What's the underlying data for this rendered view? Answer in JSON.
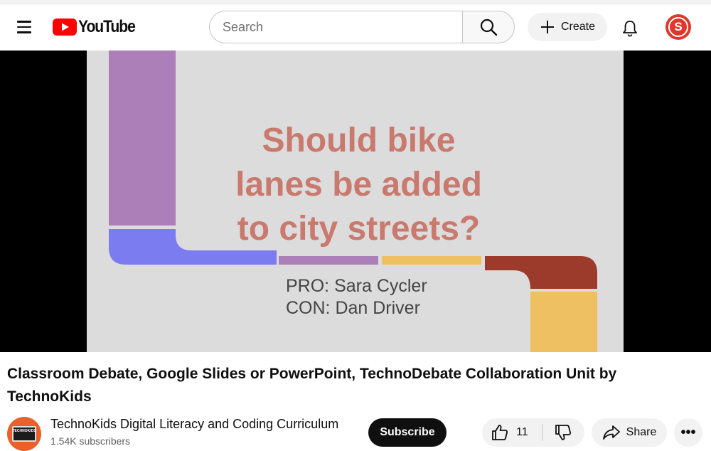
{
  "header": {
    "logo_text": "YouTube",
    "search_placeholder": "Search",
    "create_label": "Create",
    "avatar_letter": "S"
  },
  "slide": {
    "title_lines": [
      "Should bike",
      "lanes be added",
      "to city streets?"
    ],
    "pro_line": "PRO: Sara Cycler",
    "con_line": "CON: Dan Driver"
  },
  "video": {
    "title": "Classroom Debate, Google Slides or PowerPoint, TechnoDebate Collaboration Unit by TechnoKids"
  },
  "channel": {
    "name": "TechnoKids Digital Literacy and Coding Curriculum",
    "subscribers": "1.54K subscribers",
    "avatar_label": "TECHNOKIDS"
  },
  "actions": {
    "subscribe_label": "Subscribe",
    "like_count": "11",
    "share_label": "Share",
    "more_label": "•••"
  },
  "colors": {
    "brand_red": "#ff0000",
    "slide_title": "#c9796d",
    "lilac": "#ad7fb8",
    "blue": "#7b7cf0",
    "gold": "#eec061",
    "maroon": "#9c3a2c"
  }
}
